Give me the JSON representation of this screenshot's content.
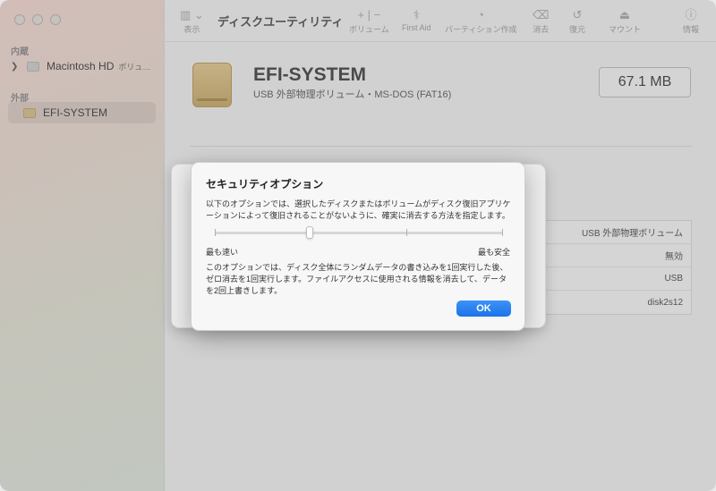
{
  "sidebar": {
    "section_internal": "内蔵",
    "section_external": "外部",
    "internal_disk": {
      "name": "Macintosh HD",
      "sub": "ボリュ…"
    },
    "external_disk": {
      "name": "EFI-SYSTEM"
    }
  },
  "toolbar": {
    "view_label": "表示",
    "title": "ディスクユーティリティ",
    "volume_label": "ボリューム",
    "first_aid_label": "First Aid",
    "partition_label": "パーティション作成",
    "erase_label": "消去",
    "restore_label": "復元",
    "mount_label": "マウント",
    "info_label": "情報",
    "add_symbol": "+",
    "remove_symbol": "−"
  },
  "volume": {
    "name": "EFI-SYSTEM",
    "description": "USB 外部物理ボリューム・MS-DOS (FAT16)",
    "size": "67.1 MB"
  },
  "info_table": {
    "rows": [
      "USB 外部物理ボリューム",
      "無効",
      "USB",
      "disk2s12"
    ]
  },
  "security_dialog": {
    "title": "セキュリティオプション",
    "description": "以下のオプションでは、選択したディスクまたはボリュームがディスク復旧アプリケーションによって復旧されることがないように、確実に消去する方法を指定します。",
    "min_label": "最も速い",
    "max_label": "最も安全",
    "slider_level_fraction": 0.33,
    "explanation": "このオプションでは、ディスク全体にランダムデータの書き込みを1回実行した後、ゼロ消去を1回実行します。ファイルアクセスに使用される情報を消去して、データを2回上書きします。",
    "ok_label": "OK"
  },
  "colors": {
    "accent": "#1a73e8",
    "drive_gold": "#d4b572"
  }
}
